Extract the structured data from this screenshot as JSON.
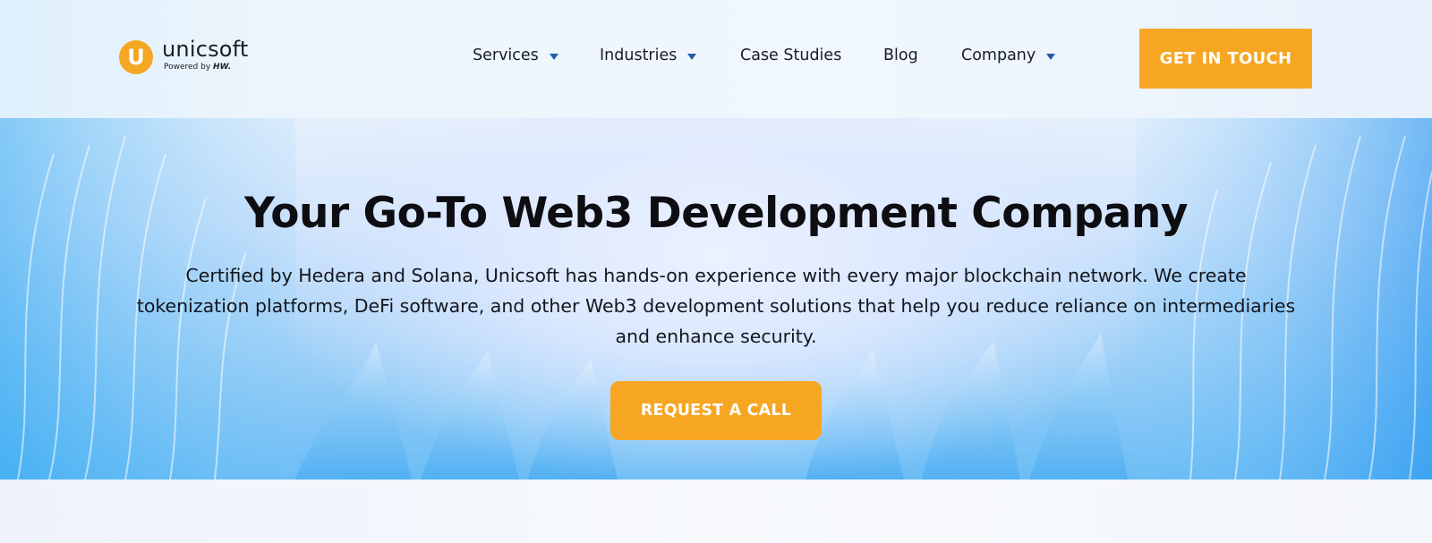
{
  "brand": {
    "name": "unicsoft",
    "tagline_prefix": "Powered by",
    "tagline_brand": "HW.",
    "accent": "#f6a623"
  },
  "nav": {
    "items": [
      {
        "label": "Services",
        "dropdown": true
      },
      {
        "label": "Industries",
        "dropdown": true
      },
      {
        "label": "Case Studies",
        "dropdown": false
      },
      {
        "label": "Blog",
        "dropdown": false
      },
      {
        "label": "Company",
        "dropdown": true
      }
    ],
    "cta_label": "GET IN TOUCH"
  },
  "hero": {
    "title": "Your Go-To Web3 Development Company",
    "description": "Certified by Hedera and Solana, Unicsoft has hands-on experience with every major blockchain network. We create tokenization platforms, DeFi software, and other Web3 development solutions that help you reduce reliance on intermediaries and enhance security.",
    "cta_label": "REQUEST A CALL"
  },
  "icons": {
    "logo": "unicsoft-u-logo-icon",
    "dropdown": "caret-down-icon"
  }
}
